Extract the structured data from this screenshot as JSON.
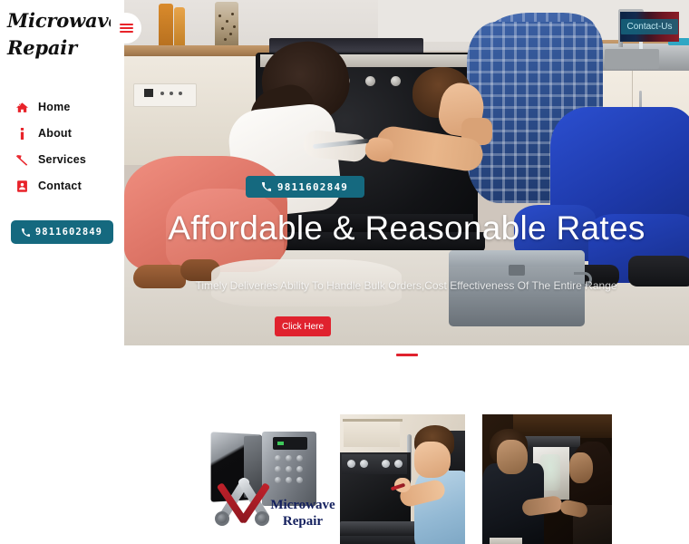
{
  "site": {
    "logo_line1": "Microwave",
    "logo_line2": "Repair",
    "accent_red": "#e8232a",
    "accent_teal": "#15697f",
    "cta_red": "#e0222e",
    "logo_text_color": "#111111"
  },
  "header": {
    "menu_toggle_name": "hamburger-menu",
    "contact_button_label": "Contact-Us"
  },
  "sidebar": {
    "items": [
      {
        "label": "Home",
        "icon": "home-icon"
      },
      {
        "label": "About",
        "icon": "info-icon"
      },
      {
        "label": "Services",
        "icon": "wrench-icon"
      },
      {
        "label": "Contact",
        "icon": "address-book-icon"
      }
    ],
    "phone": {
      "number": "9811602849",
      "icon": "phone-icon"
    }
  },
  "hero": {
    "phone_badge": {
      "number": "9811602849",
      "icon": "phone-icon"
    },
    "title": "Affordable & Reasonable Rates",
    "subtitle": "Timely Deliveries Ability To Handle Bulk Orders,Cost Effectiveness Of The Entire Range",
    "cta_label": "Click Here",
    "slides_count": 1,
    "active_slide": 1
  },
  "gallery": {
    "items": [
      {
        "name": "microwave-repair-logo",
        "caption_line1": "Microwave",
        "caption_line2": "Repair",
        "alt": "Microwave repair logo with crossed wrench and screwdriver"
      },
      {
        "name": "technician-repairing-oven",
        "alt": "Technician in light blue shirt repairing a built-in oven"
      },
      {
        "name": "couple-at-open-microwave",
        "alt": "Man and woman looking into an open lit microwave"
      }
    ]
  }
}
